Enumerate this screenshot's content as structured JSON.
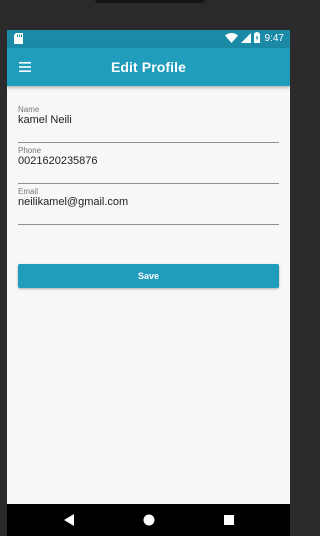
{
  "status_bar": {
    "time": "9:47",
    "icons": [
      "sd-card-icon",
      "wifi-icon",
      "signal-icon",
      "battery-icon"
    ]
  },
  "app_bar": {
    "title": "Edit Profile",
    "menu_icon": "hamburger-menu-icon"
  },
  "form": {
    "fields": [
      {
        "label": "Name",
        "value": "kamel Neili"
      },
      {
        "label": "Phone",
        "value": "0021620235876"
      },
      {
        "label": "Email",
        "value": "neilikamel@gmail.com"
      }
    ],
    "save_label": "Save"
  },
  "nav": {
    "icons": [
      "back-icon",
      "home-icon",
      "recents-icon"
    ]
  },
  "colors": {
    "primary": "#209cbd",
    "status_bar": "#1a8aa6",
    "background": "#f7f7f7"
  }
}
